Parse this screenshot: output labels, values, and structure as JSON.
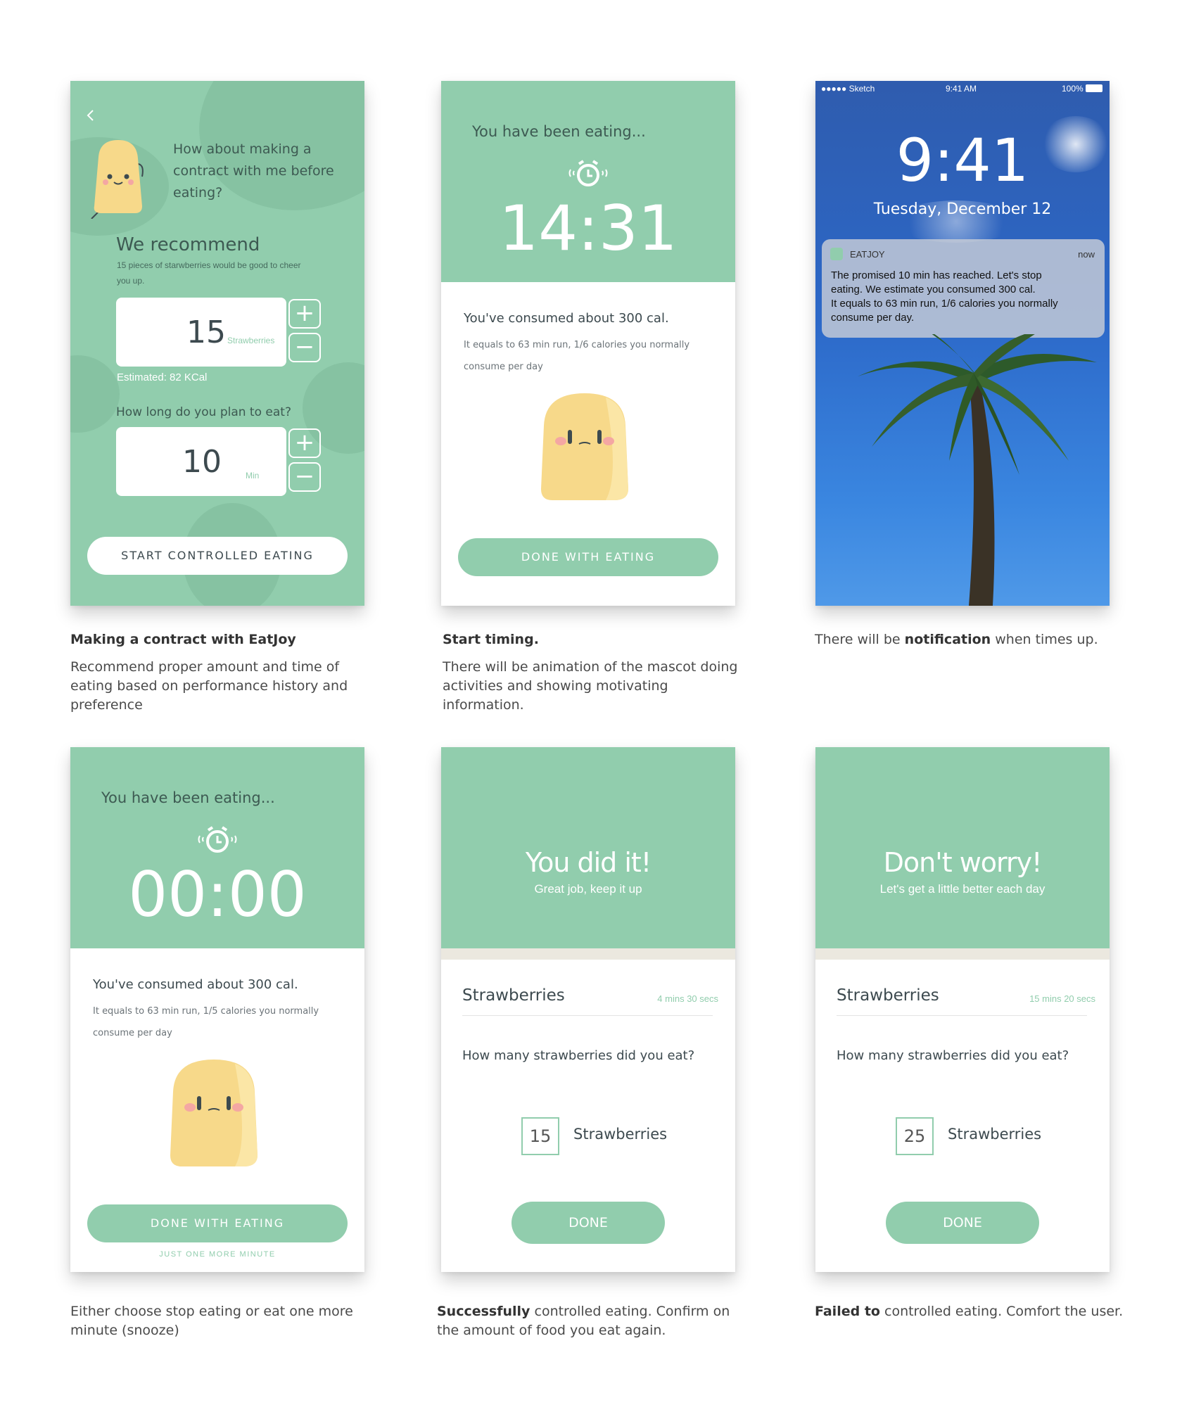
{
  "colors": {
    "brand_green": "#91cdad",
    "mascot_yellow": "#f7d98a",
    "text_dark": "#3d4a4f"
  },
  "contract": {
    "back_icon": "chevron-left-icon",
    "question": [
      "How about making a",
      "contract with me before",
      "eating?"
    ],
    "recommend_title": "We recommend",
    "recommend_sub": [
      "15 pieces of starwberries would be good to cheer",
      "you up."
    ],
    "amount": "15",
    "amount_unit": "Strawberries",
    "estimated": "Estimated: 82 KCal",
    "duration_question": "How long do you plan to eat?",
    "duration": "10",
    "duration_unit": "Min",
    "plus": "+",
    "minus": "−",
    "start_button": "START CONTROLLED EATING"
  },
  "timing": {
    "heading": "You have been eating...",
    "time": "14:31",
    "consumed": "You've consumed about 300 cal.",
    "detail": [
      "It equals to 63 min run, 1/6 calories you normally",
      "consume per day"
    ],
    "done_button": "DONE WITH EATING"
  },
  "lockscreen": {
    "carrier": "●●●●● Sketch",
    "clock": "9:41 AM",
    "battery": "100%",
    "big_time": "9:41",
    "date": "Tuesday, December 12",
    "app_name": "EATJOY",
    "when": "now",
    "message": [
      "The promised 10 min has reached. Let's stop",
      "eating. We estimate you consumed 300 cal.",
      "It equals to 63 min run, 1/6 calories you normally",
      "consume per day."
    ]
  },
  "timeup": {
    "heading": "You have been eating...",
    "time": "00:00",
    "consumed": "You've consumed about 300 cal.",
    "detail": [
      "It equals to 63 min run, 1/5 calories you normally",
      "consume per day"
    ],
    "done_button": "DONE WITH EATING",
    "snooze": "JUST ONE MORE MINUTE"
  },
  "success": {
    "title": "You did it!",
    "subtitle": "Great job, keep it up",
    "food": "Strawberries",
    "duration": "4 mins 30 secs",
    "question": "How many strawberries did you eat?",
    "count": "15",
    "count_unit": "Strawberries",
    "done_button": "DONE"
  },
  "fail": {
    "title": "Don't worry!",
    "subtitle": "Let's get a little better each day",
    "food": "Strawberries",
    "duration": "15 mins 20 secs",
    "question": "How many strawberries did you eat?",
    "count": "25",
    "count_unit": "Strawberries",
    "done_button": "DONE"
  },
  "captions": {
    "c1_title": "Making a contract with EatJoy",
    "c1_body": [
      "Recommend proper amount and time of",
      "eating based on performance history and",
      "preference"
    ],
    "c2_title": "Start timing.",
    "c2_body": [
      "There will be animation of the mascot doing",
      "activities and showing motivating",
      "information."
    ],
    "c3_pre": "There will be ",
    "c3_bold": "notification",
    "c3_post": " when times up.",
    "c4_body": [
      "Either choose stop eating or eat one more",
      "minute (snooze)"
    ],
    "c5_bold": "Successfully",
    "c5_rest": " controlled eating. Confirm on",
    "c5_line2": "the amount of food you eat again.",
    "c6_bold": "Failed to",
    "c6_rest": " controlled eating. Comfort the user."
  }
}
